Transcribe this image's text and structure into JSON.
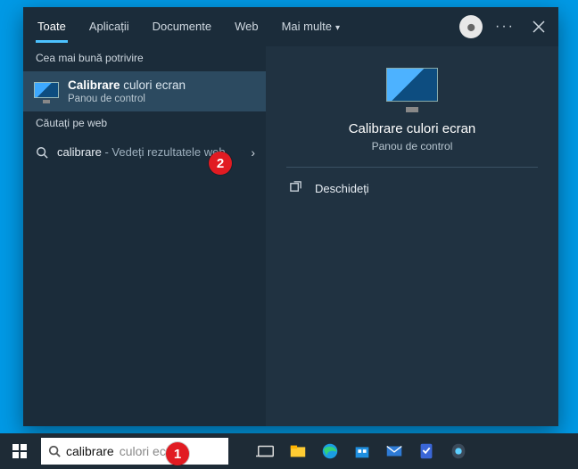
{
  "tabs": {
    "all": "Toate",
    "apps": "Aplicații",
    "documents": "Documente",
    "web": "Web",
    "more": "Mai multe"
  },
  "sections": {
    "bestMatch": "Cea mai bună potrivire",
    "searchWeb": "Căutați pe web"
  },
  "bestMatch": {
    "titleBold": "Calibrare",
    "titleRest": " culori ecran",
    "subtitle": "Panou de control"
  },
  "webResult": {
    "term": "calibrare",
    "suffix": " - Vedeți rezultatele web"
  },
  "preview": {
    "title": "Calibrare culori ecran",
    "subtitle": "Panou de control",
    "openLabel": "Deschideți"
  },
  "search": {
    "typed": "calibrare",
    "ghost": " culori ecran"
  },
  "badges": {
    "one": "1",
    "two": "2"
  }
}
